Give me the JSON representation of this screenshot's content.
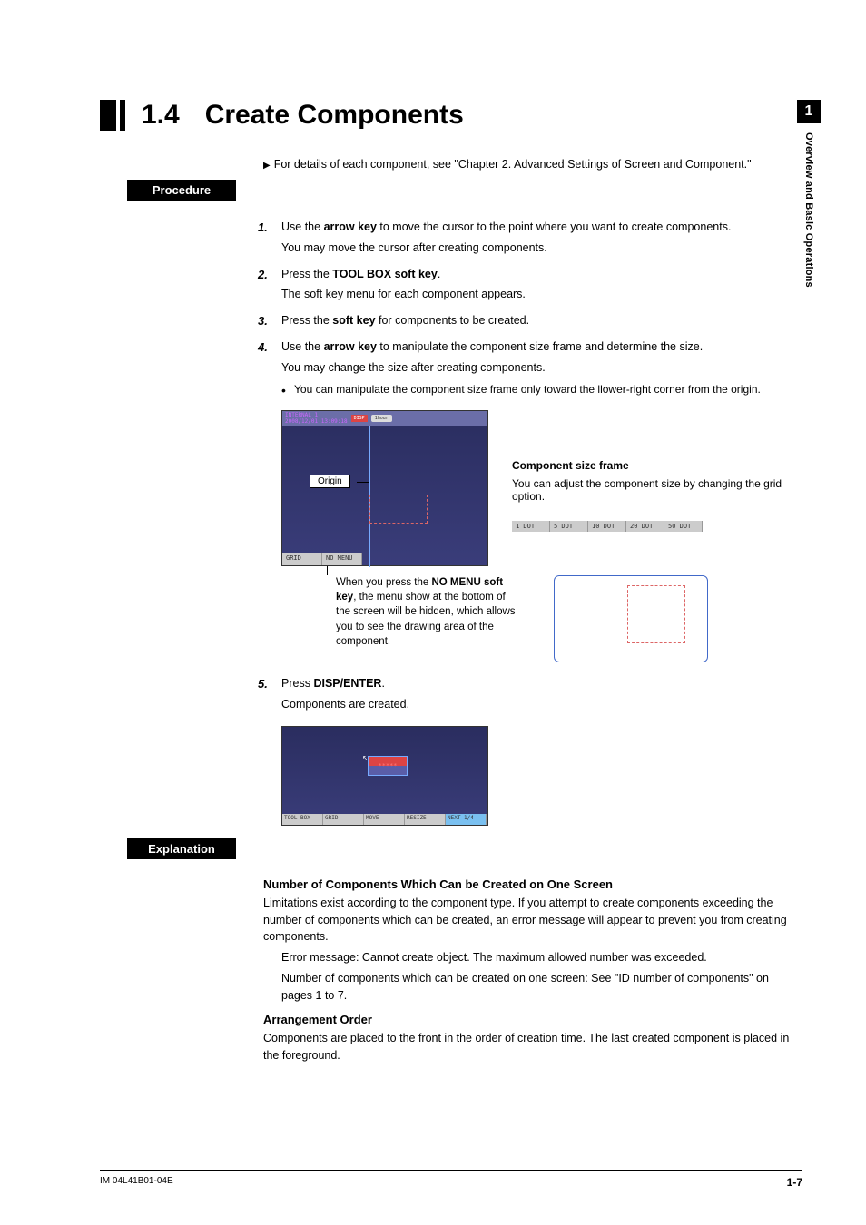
{
  "sideTab": {
    "num": "1",
    "text": "Overview and Basic Operations"
  },
  "heading": {
    "num": "1.4",
    "title": "Create Components"
  },
  "topNote": "For details of each component, see \"Chapter 2.  Advanced Settings of Screen and Component.\"",
  "labels": {
    "procedure": "Procedure",
    "explanation": "Explanation"
  },
  "steps": {
    "s1a": "Use the ",
    "s1b": "arrow key",
    "s1c": " to move the cursor to the point where you want to create components.",
    "s1sub": "You may move the cursor after creating components.",
    "s2a": "Press the ",
    "s2b": "TOOL BOX soft key",
    "s2c": ".",
    "s2sub": "The soft key menu for each component appears.",
    "s3a": "Press the ",
    "s3b": "soft key",
    "s3c": " for components to be created.",
    "s4a": "Use the ",
    "s4b": "arrow key",
    "s4c": " to manipulate the component size frame and determine the size.",
    "s4sub": "You may change the size after creating components.",
    "s4bullet": "You can manipulate the component size frame only toward the llower-right corner from the origin.",
    "s5a": "Press ",
    "s5b": "DISP/ENTER",
    "s5c": ".",
    "s5sub": "Components are created."
  },
  "fig1": {
    "headerLine1": "INTERNAL 1",
    "headerLine2": "2008/12/01 13:09:18",
    "badge": "DISP",
    "pill": "1hour",
    "originLabel": "Origin",
    "footBtns": [
      "GRID",
      "NO MENU"
    ],
    "rightTitle": "Component size frame",
    "rightText": "You can adjust the component size by changing the grid option.",
    "dotBtns": [
      "1 DOT",
      "5 DOT",
      "10 DOT",
      "20 DOT",
      "50 DOT"
    ],
    "callout1": "When you press the ",
    "callout1b": "NO MENU soft key",
    "callout1c": ", the menu show at the bottom of the screen will be hidden, which allows you to see the drawing area of the component."
  },
  "fig2": {
    "componentText": "*****",
    "btns": [
      "TOOL BOX",
      "GRID",
      "MOVE",
      "RESIZE",
      "NEXT 1/4"
    ]
  },
  "explain": {
    "h1": "Number of Components Which Can be Created on One Screen",
    "p1": "Limitations exist according to the component type. If you attempt to create components exceeding the number of components which can be created, an error message will appear to prevent you from creating components.",
    "p2": "Error message: Cannot create object. The maximum allowed number was exceeded.",
    "p3": "Number of components which can be created on one screen: See \"ID number of components\" on pages 1 to 7.",
    "h2": "Arrangement Order",
    "p4": "Components are placed to the front in the order of creation time. The last created component is placed in the foreground."
  },
  "footer": {
    "left": "IM 04L41B01-04E",
    "right": "1-7"
  }
}
